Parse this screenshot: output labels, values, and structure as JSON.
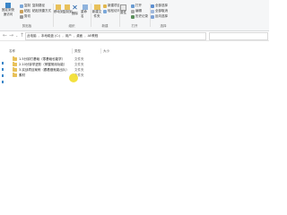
{
  "ribbon": {
    "groups": [
      {
        "title": "剪贴板",
        "items": [
          "固定到快速访问",
          "复制",
          "粘贴",
          "剪切",
          "复制路径",
          "粘贴快捷方式"
        ]
      },
      {
        "title": "组织",
        "items": [
          "移动到",
          "复制到",
          "删除",
          "重命名"
        ]
      },
      {
        "title": "新建",
        "items": [
          "新建文件夹",
          "新建项目",
          "轻松访问"
        ]
      },
      {
        "title": "打开",
        "items": [
          "属性",
          "打开",
          "编辑",
          "历史记录"
        ]
      },
      {
        "title": "选择",
        "items": [
          "全部选择",
          "全部取消",
          "反向选择"
        ]
      }
    ]
  },
  "address": {
    "crumbs": [
      "此电脑",
      "本地磁盘 (C:)",
      "用户",
      "桌面",
      "AE教程"
    ],
    "search_placeholder": ""
  },
  "columns": [
    "名称",
    "类型",
    "大小"
  ],
  "rows": [
    {
      "name": "1.5分钟打基础（零基础也能学）",
      "type": "文件夹"
    },
    {
      "name": "2.10分钟学进阶（掌握常用功能）",
      "type": "文件夹"
    },
    {
      "name": "3.实战项目案例（跟着做就能出片）",
      "type": "文件夹"
    },
    {
      "name": "素材",
      "type": "文件夹"
    }
  ],
  "colors": {
    "folder": "#e8c15a",
    "ribbon_bg": "#f5f6f7",
    "cursor_highlight": "#f2de2a",
    "pin": "#3c86c8"
  }
}
